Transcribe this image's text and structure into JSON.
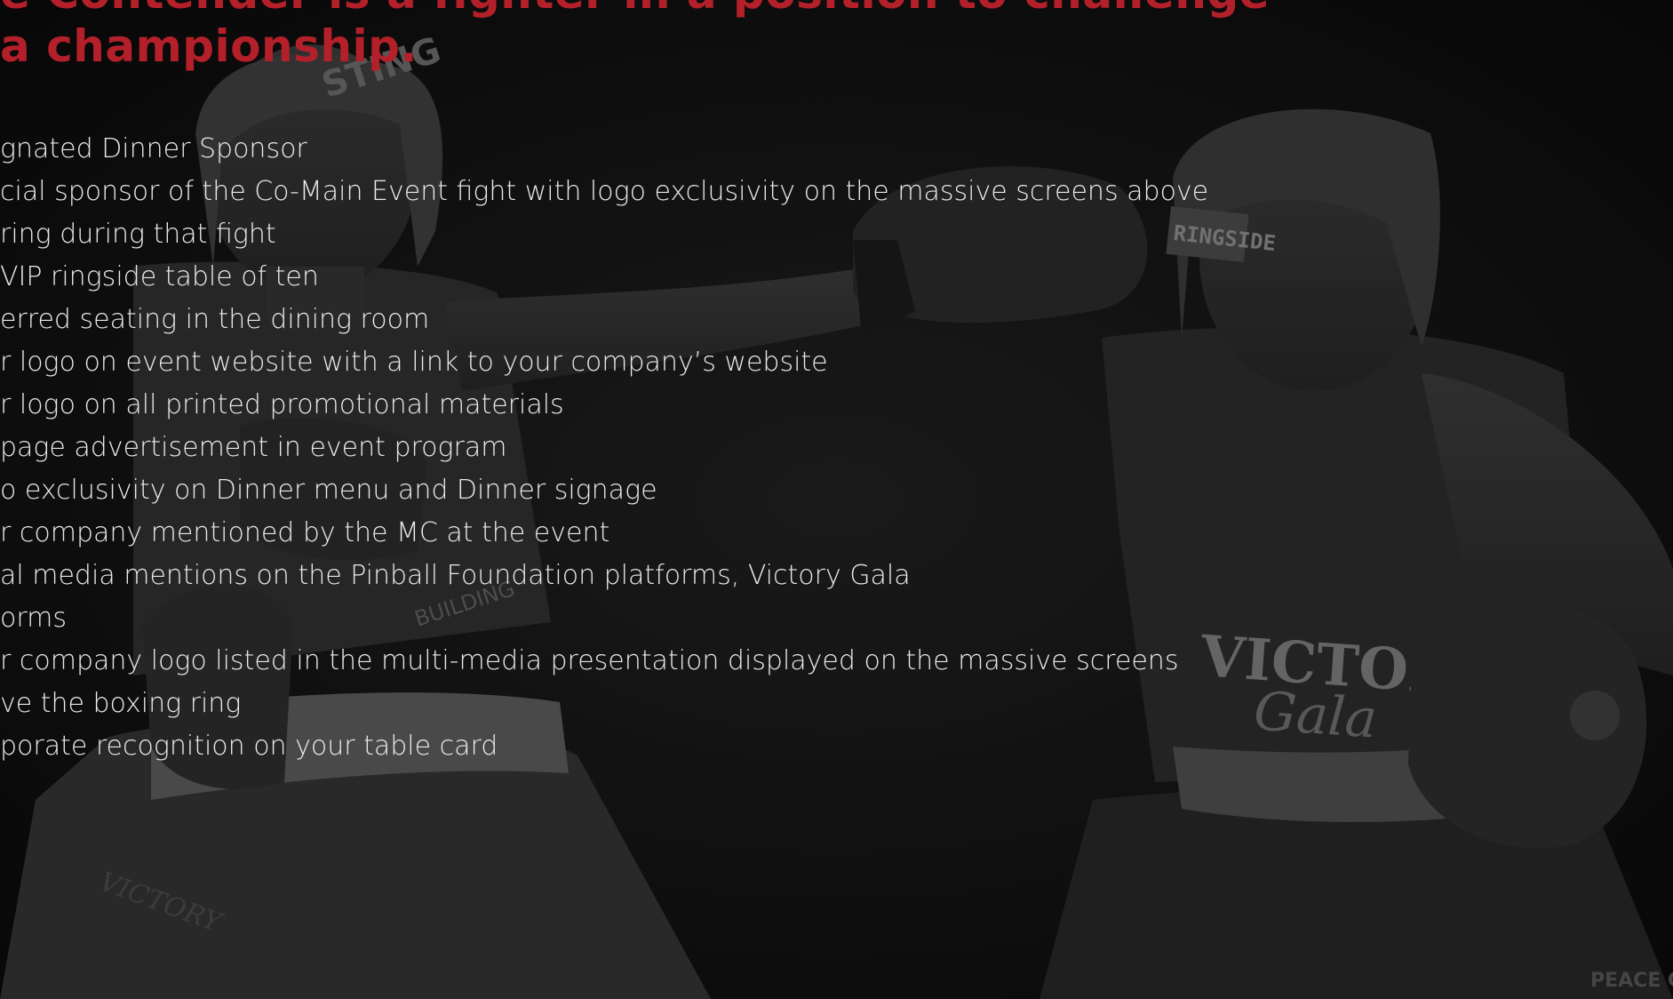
{
  "heading": {
    "line1": "e Contender is a fighter in a position to challenge",
    "line2": "a championship."
  },
  "benefits": [
    "gnated Dinner Sponsor",
    "cial sponsor of the Co-Main Event fight with logo exclusivity on the massive screens above",
    "ring during that fight",
    " VIP ringside table of ten",
    "erred seating in the dining room",
    "r logo on event website with a link to your company’s website",
    "r logo on all printed promotional materials",
    " page advertisement in event program",
    "o exclusivity on Dinner menu and Dinner signage",
    "r company mentioned by the MC at the event",
    "al media mentions on the Pinball Foundation platforms, Victory Gala",
    "orms",
    "r company logo listed in the multi-media presentation displayed on the massive screens",
    "ve the boxing ring",
    "porate recognition on your table card"
  ],
  "photo_text": {
    "headgear_left": "STING",
    "headgear_right": "RINGSIDE",
    "jersey_right_line1": "VICTORY",
    "jersey_right_line2": "Gala",
    "jersey_left": "BUILDING",
    "shorts_left": "VICTORY",
    "corner_right": "PEACE COTT"
  },
  "colors": {
    "heading": "#b4202a",
    "text": "#e9e9e9",
    "background": "#0a0a0a"
  }
}
